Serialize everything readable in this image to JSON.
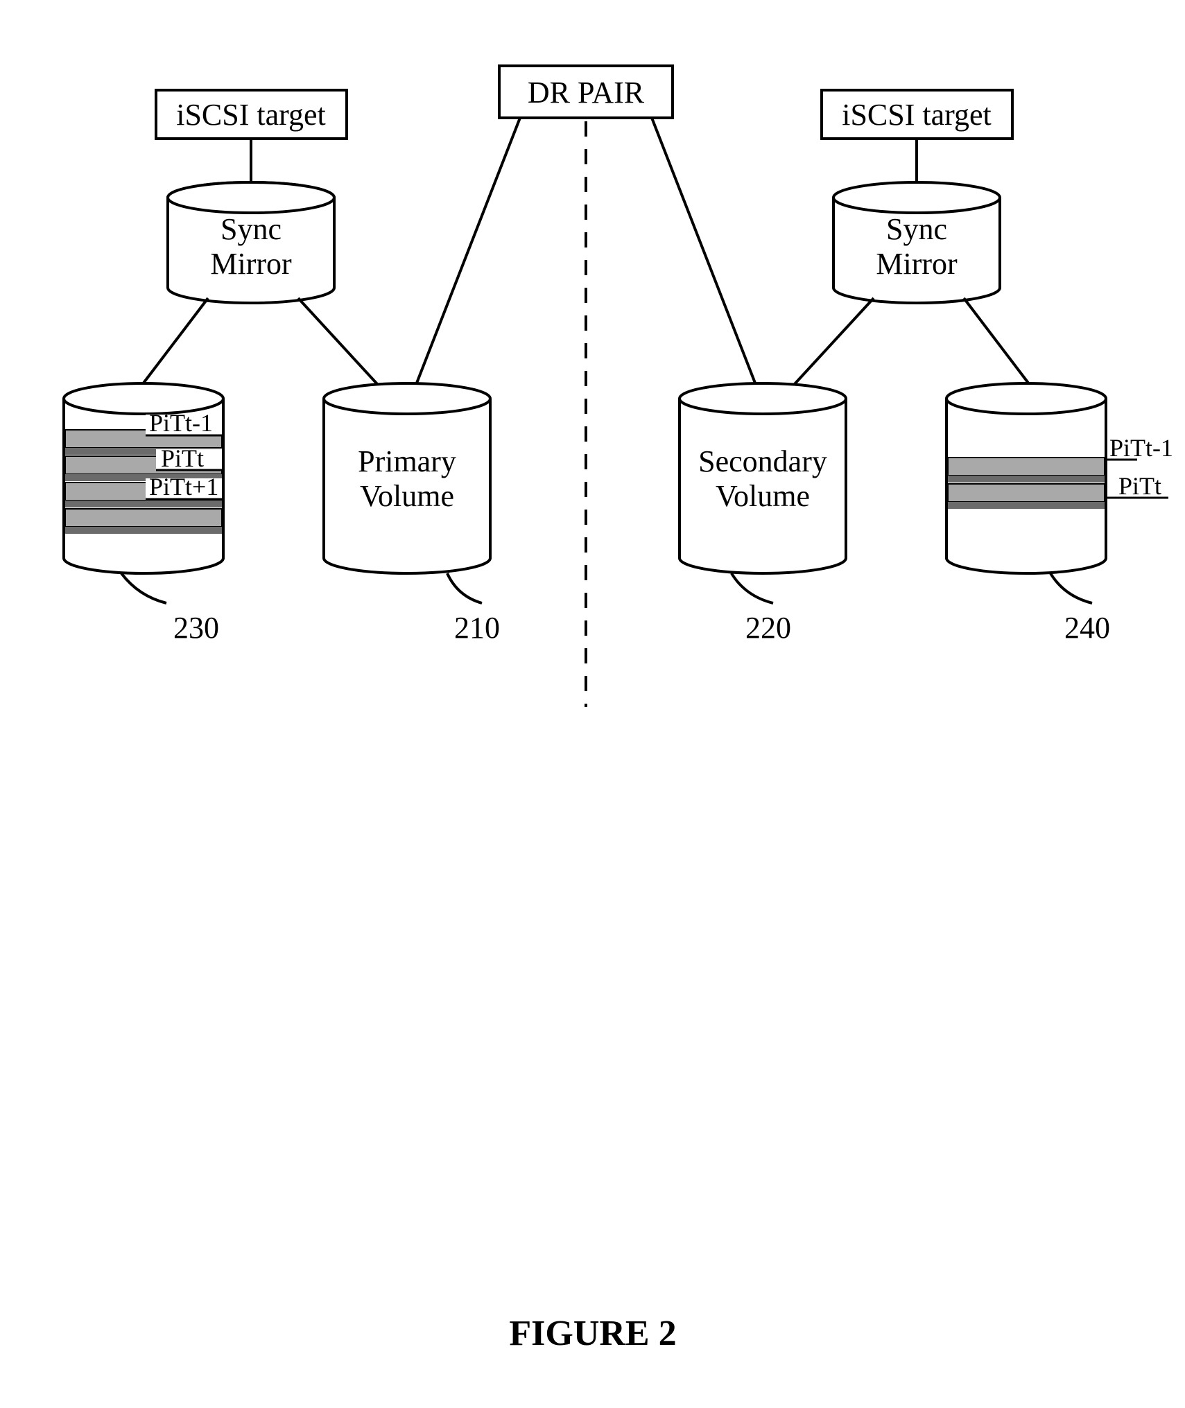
{
  "header": {
    "dr_pair": "DR PAIR"
  },
  "left": {
    "iscsi": "iSCSI target",
    "sync1": "Sync",
    "sync2": "Mirror",
    "primary1": "Primary",
    "primary2": "Volume",
    "ref_pit": "230",
    "ref_primary": "210",
    "pit1": "PiTt-1",
    "pit2": "PiTt",
    "pit3": "PiTt+1"
  },
  "right": {
    "iscsi": "iSCSI target",
    "sync1": "Sync",
    "sync2": "Mirror",
    "secondary1": "Secondary",
    "secondary2": "Volume",
    "ref_pit": "240",
    "ref_secondary": "220",
    "pit1": "PiTt-1",
    "pit2": "PiTt"
  },
  "figure": "FIGURE 2"
}
